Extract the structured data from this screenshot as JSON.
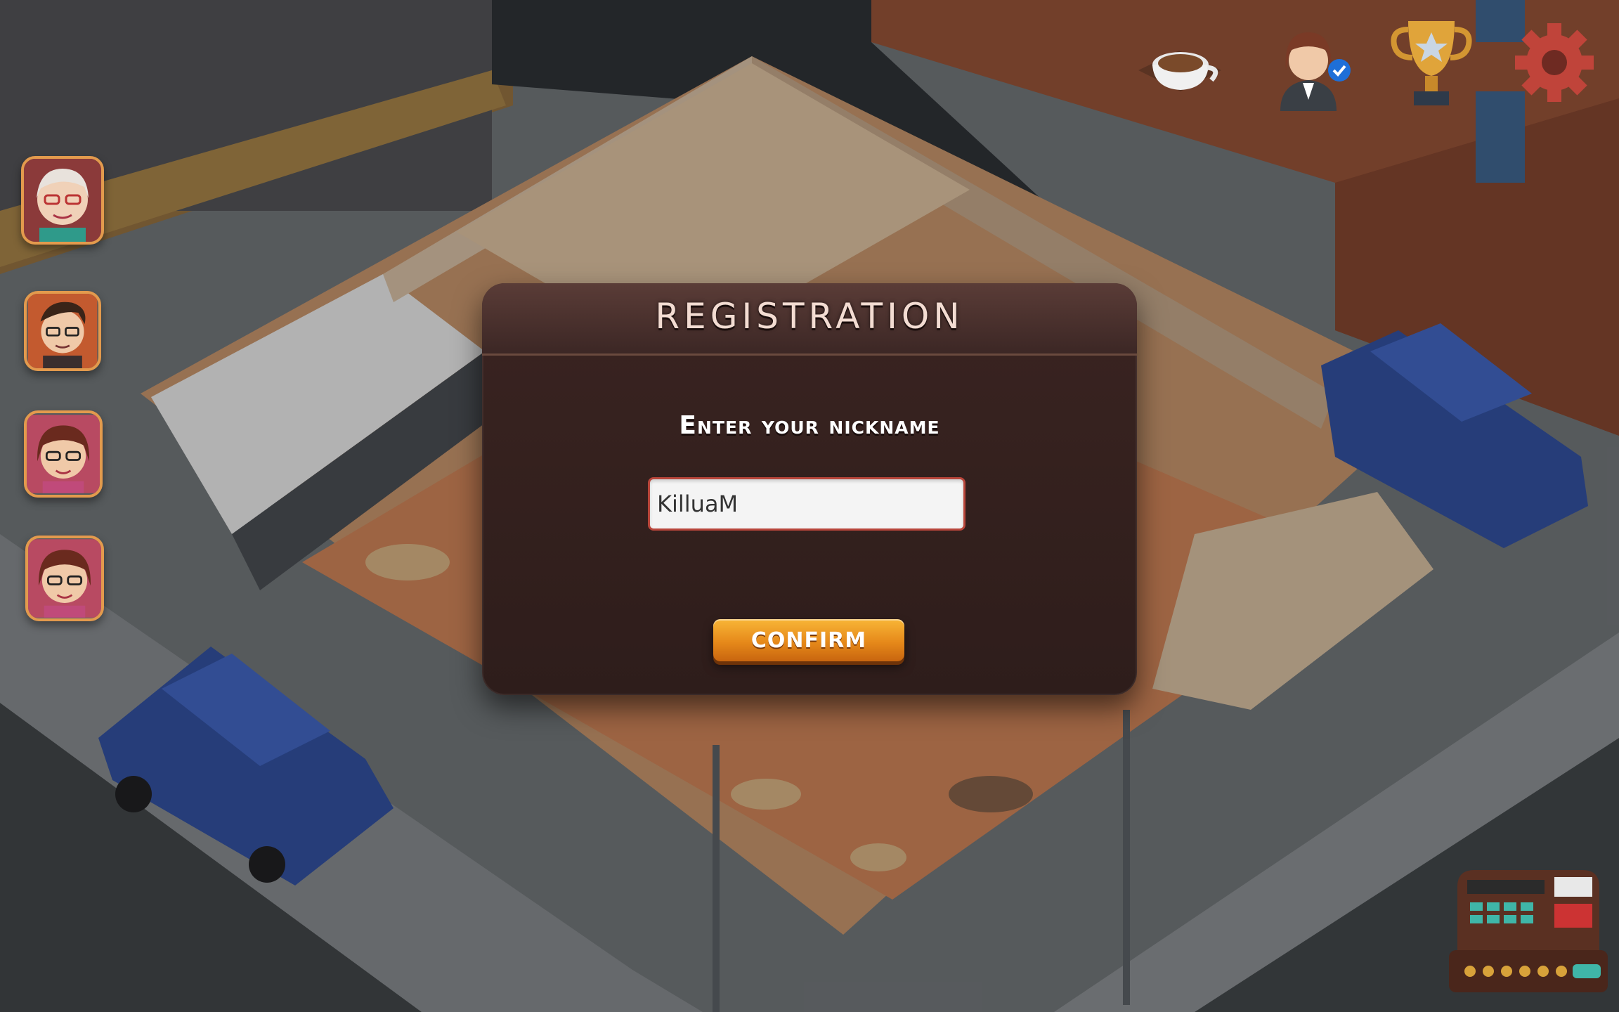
{
  "modal": {
    "title": "REGISTRATION",
    "prompt": "Enter your nickname",
    "nickname_value": "KilluaM",
    "confirm_label": "CONFIRM"
  },
  "hud": {
    "icons": [
      "coffee-cup-icon",
      "manager-avatar-icon",
      "trophy-icon",
      "settings-gear-icon"
    ]
  },
  "avatars": [
    "avatar-grandma",
    "avatar-man-glasses",
    "avatar-girl-glasses-1",
    "avatar-girl-glasses-2"
  ],
  "colors": {
    "modal_bg": "#2e1d1b",
    "modal_header": "#4a302c",
    "button_orange": "#e6891a",
    "input_border": "#b9463b"
  }
}
